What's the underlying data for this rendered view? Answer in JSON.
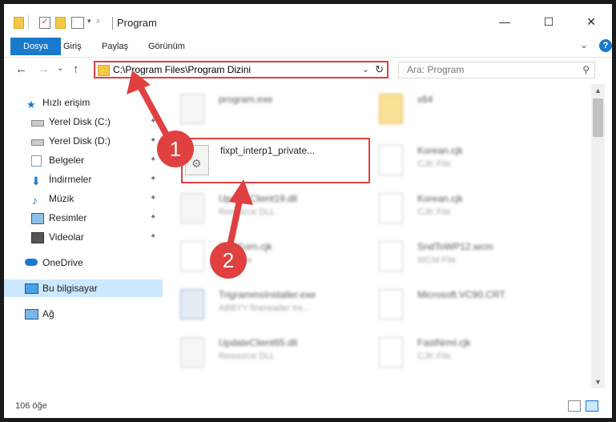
{
  "window": {
    "title": "Program",
    "controls": {
      "minimize": "—",
      "maximize": "☐",
      "close": "✕"
    }
  },
  "ribbon": {
    "tabs": [
      "Dosya",
      "Giriş",
      "Paylaş",
      "Görünüm"
    ],
    "expand": "⌄",
    "help": "?"
  },
  "nav": {
    "back": "←",
    "forward": "→",
    "recent": "⌄",
    "up": "↑",
    "address": "C:\\Program Files\\Program Dizini",
    "search_placeholder": "Ara: Program"
  },
  "sidebar": {
    "items": [
      {
        "label": "Hızlı erişim",
        "icon": "star-icon",
        "pinned": false
      },
      {
        "label": "Yerel Disk (C:)",
        "icon": "drive-icon",
        "pinned": true
      },
      {
        "label": "Yerel Disk (D:)",
        "icon": "drive-icon",
        "pinned": true
      },
      {
        "label": "Belgeler",
        "icon": "documents-icon",
        "pinned": true
      },
      {
        "label": "İndirmeler",
        "icon": "download-icon",
        "pinned": true
      },
      {
        "label": "Müzik",
        "icon": "music-icon",
        "pinned": true
      },
      {
        "label": "Resimler",
        "icon": "pictures-icon",
        "pinned": true
      },
      {
        "label": "Videolar",
        "icon": "videos-icon",
        "pinned": true
      },
      {
        "label": "OneDrive",
        "icon": "cloud-icon",
        "pinned": false
      },
      {
        "label": "Bu bilgisayar",
        "icon": "computer-icon",
        "pinned": false,
        "selected": true
      },
      {
        "label": "Ağ",
        "icon": "network-icon",
        "pinned": false
      }
    ],
    "pin_glyph": "📌"
  },
  "files": [
    {
      "name": "program.exe",
      "type": "",
      "icon": "exe-icon",
      "blurred": true
    },
    {
      "name": "x64",
      "type": "",
      "icon": "folder-icon",
      "blurred": true
    },
    {
      "name": "fixpt_interp1_private...",
      "type": "",
      "icon": "dll-gear-icon",
      "blurred": false,
      "highlighted": true
    },
    {
      "name": "Korean.cjk",
      "type": "CJK File",
      "icon": "file-icon",
      "blurred": true
    },
    {
      "name": "UpdateClient19.dll",
      "type": "Resource DLL",
      "icon": "dll-gear-icon",
      "blurred": true
    },
    {
      "name": "Korean.cjk",
      "type": "CJK File",
      "icon": "file-icon",
      "blurred": true
    },
    {
      "name": "FastKorn.cjk",
      "type": "CJK File",
      "icon": "file-icon",
      "blurred": true
    },
    {
      "name": "SndToWP12.wcm",
      "type": "WCM File",
      "icon": "file-icon",
      "blurred": true
    },
    {
      "name": "TrigrammsInstaller.exe",
      "type": "ABBYY finereader tre...",
      "icon": "installer-icon",
      "blurred": true
    },
    {
      "name": "Microsoft.VC90.CRT",
      "type": "",
      "icon": "file-icon",
      "blurred": true
    },
    {
      "name": "UpdateClient65.dll",
      "type": "Resource DLL",
      "icon": "dll-gear-icon",
      "blurred": true
    },
    {
      "name": "FastNrml.cjk",
      "type": "CJK File",
      "icon": "file-icon",
      "blurred": true
    }
  ],
  "annotations": {
    "badge1": "1",
    "badge2": "2",
    "color": "#e04040"
  },
  "status": {
    "item_count": "106 öğe"
  },
  "colors": {
    "accent": "#1979ca",
    "selection": "#cce8ff",
    "annotation": "#e04040"
  }
}
